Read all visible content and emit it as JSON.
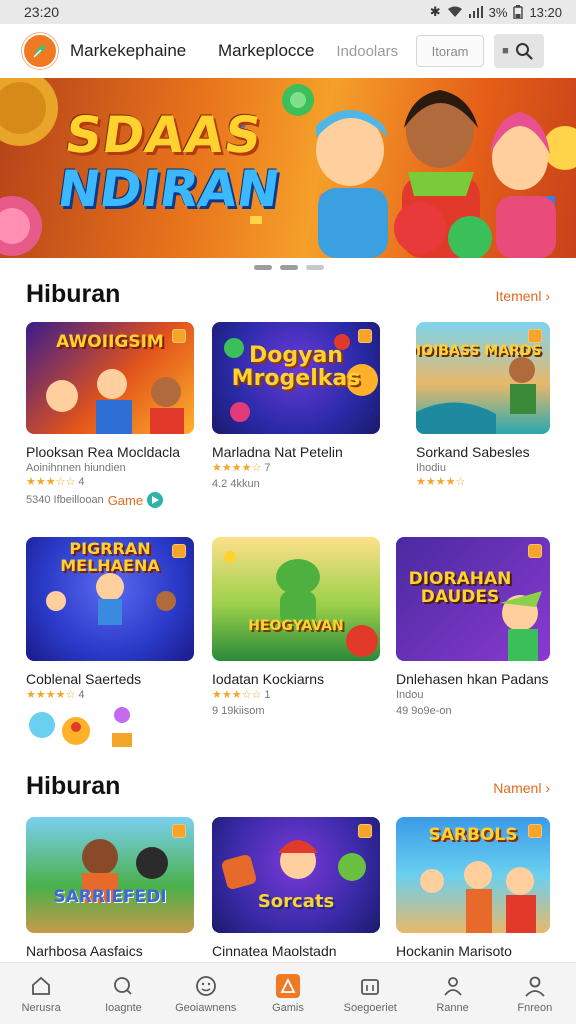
{
  "status_bar": {
    "time": "23:20",
    "battery": "3%",
    "clock": "13:20"
  },
  "header": {
    "app_name": "Markekephaine",
    "nav_primary": "Markeplocce",
    "nav_secondary": "Indoolars",
    "search_placeholder": "Itoram"
  },
  "banner": {
    "title_line1": "SDAAS",
    "title_line2": "NDIRAN"
  },
  "sections": [
    {
      "title": "Hiburan",
      "see_more": "Itemenl",
      "rows": [
        [
          {
            "thumb_text": "AWOIIGSIM",
            "title": "Plooksan Rea Mocldacla",
            "subtitle": "Aoinihnnen hiundien",
            "stars": "★★★☆☆",
            "rating": "4",
            "meta": "5340 Ifbeillooan",
            "tag": "Game"
          },
          {
            "thumb_text": "Dogyan Mrogelkas",
            "title": "Marladna Nat Petelin",
            "subtitle": "",
            "stars": "★★★★☆",
            "rating": "7",
            "meta": "4.2 4kkun"
          },
          {
            "thumb_text": "DIOIBASS MARDS",
            "title": "Sorkand Sabesles",
            "subtitle": "Ihodiu",
            "stars": "★★★★☆",
            "rating": "",
            "meta": ""
          }
        ],
        [
          {
            "thumb_text": "PIGRRAN MELHAENA",
            "title": "Coblenal Saerteds",
            "subtitle": "",
            "stars": "★★★★☆",
            "rating": "4",
            "meta": ""
          },
          {
            "thumb_text": "HEOGYAVAN",
            "title": "Iodatan Kockiarns",
            "subtitle": "",
            "stars": "★★★☆☆",
            "rating": "1",
            "meta": "9 19kiisom"
          },
          {
            "thumb_text": "DIORAHAN DAUDES",
            "title": "Dnlehasen hkan Padans",
            "subtitle": "Indou",
            "stars": "",
            "rating": "",
            "meta": "49 9o9e-on"
          }
        ]
      ]
    },
    {
      "title": "Hiburan",
      "see_more": "Namenl",
      "rows": [
        [
          {
            "thumb_text": "SARRIEFEDI",
            "title": "Narhbosa Aasfaics"
          },
          {
            "thumb_text": "Sorcats",
            "title": "Cinnatea Maolstadn"
          },
          {
            "thumb_text": "SARBOLS",
            "title": "Hockanin Marisoto"
          }
        ]
      ]
    }
  ],
  "bottom_nav": [
    {
      "label": "Nerusra",
      "icon": "home-icon"
    },
    {
      "label": "Ioagnte",
      "icon": "search-icon"
    },
    {
      "label": "Geoiawnens",
      "icon": "smiley-icon"
    },
    {
      "label": "Gamis",
      "icon": "games-icon",
      "active": true
    },
    {
      "label": "Soegoeriet",
      "icon": "calendar-icon"
    },
    {
      "label": "Ranne",
      "icon": "person-icon"
    },
    {
      "label": "Fnreon",
      "icon": "profile-icon"
    }
  ],
  "colors": {
    "accent": "#f07a24",
    "link": "#e2691f",
    "star": "#f2a62a"
  }
}
